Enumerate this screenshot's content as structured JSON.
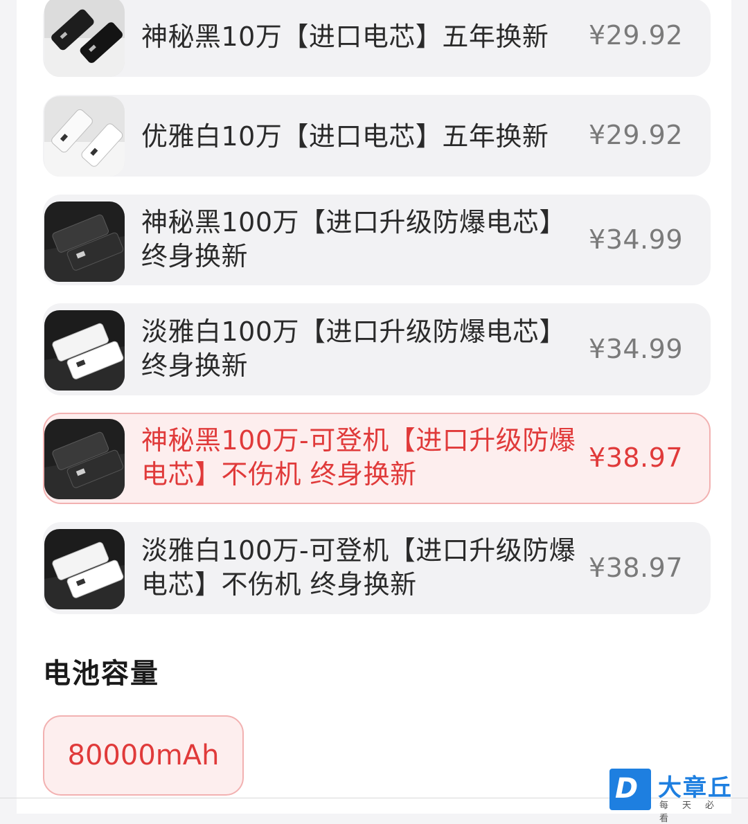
{
  "options": [
    {
      "name": "神秘黑10万【进口电芯】五年换新",
      "price": "¥29.92",
      "device_color": "black",
      "selected": false
    },
    {
      "name": "优雅白10万【进口电芯】五年换新",
      "price": "¥29.92",
      "device_color": "white",
      "selected": false
    },
    {
      "name": "神秘黑100万【进口升级防爆电芯】终身换新",
      "price": "¥34.99",
      "device_color": "black",
      "selected": false
    },
    {
      "name": "淡雅白100万【进口升级防爆电芯】终身换新",
      "price": "¥34.99",
      "device_color": "white",
      "selected": false
    },
    {
      "name": "神秘黑100万-可登机【进口升级防爆电芯】不伤机 终身换新",
      "price": "¥38.97",
      "device_color": "black",
      "selected": true
    },
    {
      "name": "淡雅白100万-可登机【进口升级防爆电芯】不伤机 终身换新",
      "price": "¥38.97",
      "device_color": "white",
      "selected": false
    }
  ],
  "capacity_section": {
    "title": "电池容量",
    "selected_option": "80000mAh"
  },
  "watermark": {
    "logo_letter": "D",
    "brand": "大章丘",
    "slogan": "每天必看"
  },
  "colors": {
    "accent": "#e03a3a",
    "selected_bg": "#fdeeee",
    "selected_border": "#f2b1b1",
    "option_bg": "#f2f2f4",
    "watermark_blue": "#1e7fe0"
  }
}
